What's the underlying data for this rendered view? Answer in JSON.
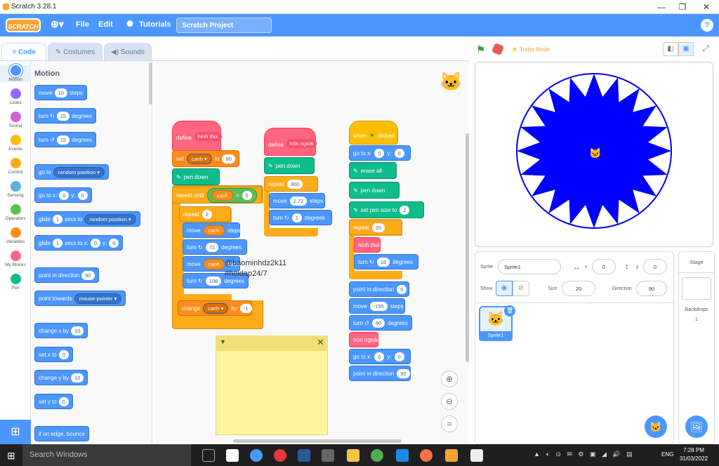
{
  "window": {
    "title": "Scratch 3.28.1"
  },
  "menubar": {
    "logo": "SCRATCH",
    "file": "File",
    "edit": "Edit",
    "tutorials": "Tutorials",
    "project_name": "Scratch Project",
    "help": "?"
  },
  "tabs": [
    {
      "label": "Code"
    },
    {
      "label": "Costumes"
    },
    {
      "label": "Sounds"
    }
  ],
  "categories": [
    {
      "label": "Motion",
      "color": "#4c97ff"
    },
    {
      "label": "Looks",
      "color": "#9966ff"
    },
    {
      "label": "Sound",
      "color": "#cf63cf"
    },
    {
      "label": "Events",
      "color": "#ffbf00"
    },
    {
      "label": "Control",
      "color": "#ffab19"
    },
    {
      "label": "Sensing",
      "color": "#5cb1d6"
    },
    {
      "label": "Operators",
      "color": "#59c059"
    },
    {
      "label": "Variables",
      "color": "#ff8c1a"
    },
    {
      "label": "My Blocks",
      "color": "#ff6680"
    },
    {
      "label": "Pen",
      "color": "#0fbd8c"
    }
  ],
  "palette": {
    "heading": "Motion",
    "blocks": [
      {
        "a": "move",
        "v": "10",
        "b": "steps"
      },
      {
        "a": "turn ↻",
        "v": "15",
        "b": "degrees"
      },
      {
        "a": "turn ↺",
        "v": "15",
        "b": "degrees"
      },
      {
        "a": "go to",
        "d": "random position ▾"
      },
      {
        "a": "go to x:",
        "v": "0",
        "b": "y:",
        "v2": "0"
      },
      {
        "a": "glide",
        "v": "1",
        "b": "secs to",
        "d": "random position ▾"
      },
      {
        "a": "glide",
        "v": "1",
        "b": "secs to x:",
        "v2": "0",
        "c": "y:",
        "v3": "0"
      },
      {
        "a": "point in direction",
        "v": "90"
      },
      {
        "a": "point towards",
        "d": "mouse-pointer ▾"
      },
      {
        "a": "change x by",
        "v": "10"
      },
      {
        "a": "set x to",
        "v": "0"
      },
      {
        "a": "change y by",
        "v": "10"
      },
      {
        "a": "set y to",
        "v": "0"
      },
      {
        "a": "if on edge, bounce"
      }
    ]
  },
  "script1": {
    "define": "define",
    "define_name": "hình thoi",
    "set": "set",
    "set_var": "canh ▾",
    "set_to": "to",
    "set_val": "90",
    "pendown": "pen down",
    "repeat_until": "repeat until",
    "cond_var": "canh",
    "cond_op": "=",
    "cond_val": "0",
    "repeat": "repeat",
    "repeat_val": "2",
    "move": "move",
    "steps": "steps",
    "var": "canh",
    "turn": "turn ↻",
    "degrees": "degrees",
    "turn_val1": "72",
    "turn_val2": "108",
    "change": "change",
    "change_var": "canh ▾",
    "change_by": "by",
    "change_val": "-1"
  },
  "script2": {
    "define": "define",
    "define_name": "tròn ngoài",
    "pendown": "pen down",
    "repeat": "repeat",
    "repeat_val": "360",
    "move": "move",
    "move_val": "2.72",
    "steps": "steps",
    "turn": "turn ↻",
    "turn_val": "1",
    "degrees": "degrees"
  },
  "script3": {
    "when": "when",
    "clicked": "clicked",
    "goto": "go to x:",
    "gx": "0",
    "gy_label": "y:",
    "gy": "0",
    "erase": "erase all",
    "pendown": "pen down",
    "pensize": "set pen size to",
    "pensize_val": "2",
    "repeat": "repeat",
    "repeat_val": "20",
    "hinhthoi": "hình thoi",
    "turn": "turn ↻",
    "turn_val": "18",
    "degrees": "degrees",
    "point": "point in direction",
    "point_val": "0",
    "move": "move",
    "move_val": "-155",
    "steps": "steps",
    "turnl": "turn ↺",
    "turnl_val": "90",
    "tronngoai": "tròn ngoài",
    "goto2": "go to x:",
    "gx2": "0",
    "gy2_label": "y:",
    "gy2": "0",
    "point2": "point in direction",
    "point2_val": "90"
  },
  "overlay": {
    "line1": "@baominhdz2k11",
    "line2": "#hoidap24/7"
  },
  "stage_header": {
    "turbo": "Turbo Mode"
  },
  "sprite_info": {
    "sprite_label": "Sprite",
    "sprite_name": "Sprite1",
    "x_label": "x",
    "x": "0",
    "y_label": "y",
    "y": "0",
    "show_label": "Show",
    "size_label": "Size",
    "size": "20",
    "direction_label": "Direction",
    "direction": "90"
  },
  "sprite_list": [
    {
      "name": "Sprite1"
    }
  ],
  "stage_pane": {
    "title": "Stage",
    "backdrops_label": "Backdrops",
    "backdrops_count": "1"
  },
  "taskbar": {
    "search": "Search Windows",
    "lang": "ENG",
    "time": "7:28 PM",
    "date": "31/03/2022"
  }
}
